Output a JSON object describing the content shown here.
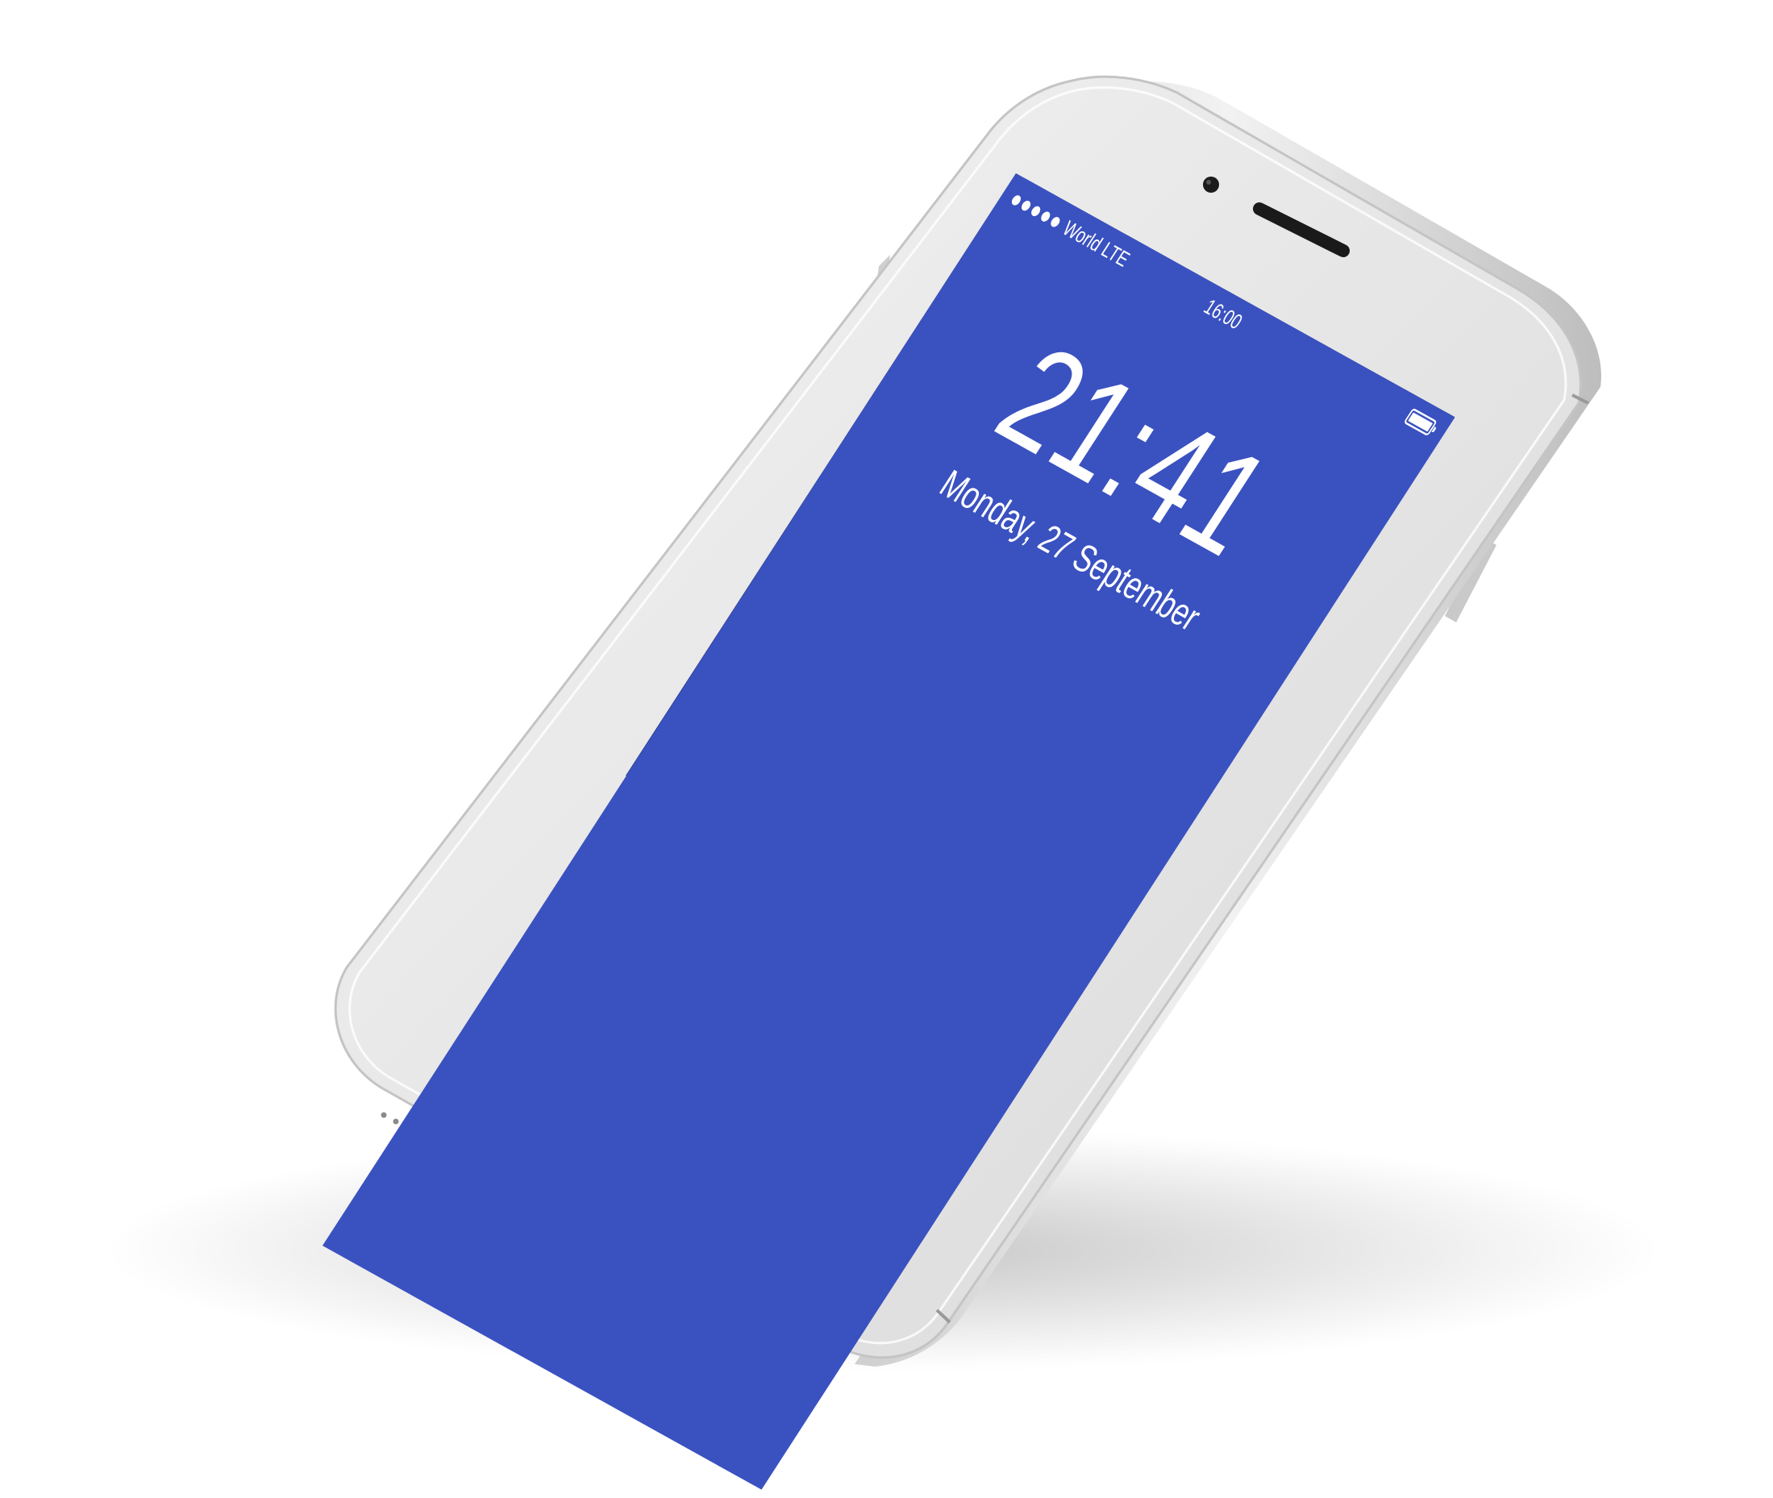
{
  "status_bar": {
    "carrier": "World LTE",
    "time": "16:00",
    "signal_bars": 5,
    "battery_level": 1.0
  },
  "lock_screen": {
    "time": "21:41",
    "date": "Monday, 27 September"
  },
  "colors": {
    "wallpaper": "#3a51c0",
    "device_body": "#e9e9e9",
    "text": "#ffffff"
  }
}
